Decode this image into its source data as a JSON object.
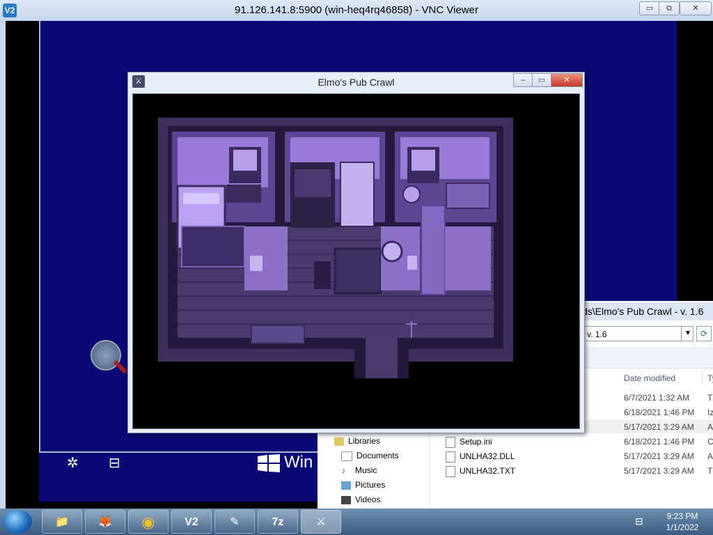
{
  "vnc": {
    "title": "91.126.141.8:5900 (win-heq4rq46858) - VNC Viewer",
    "icon_label": "V2",
    "minimize": "▭",
    "restore": "⧉",
    "close": "✕"
  },
  "desktop": {
    "win_text": "Win",
    "icons": [
      "settings-gear-icon",
      "network-monitor-icon"
    ]
  },
  "game": {
    "title": "Elmo's Pub Crawl",
    "minimize": "–",
    "maximize": "▭",
    "close": "✕"
  },
  "explorer": {
    "path_text": "ds\\Elmo's Pub Crawl - v. 1.6",
    "combo_value": "v. 1.6",
    "columns": {
      "date_modified": "Date modified",
      "type": "Ty"
    },
    "nav": [
      {
        "label": "Libraries",
        "icon": "libraries-icon"
      },
      {
        "label": "Documents",
        "icon": "documents-icon"
      },
      {
        "label": "Music",
        "icon": "music-icon"
      },
      {
        "label": "Pictures",
        "icon": "pictures-icon"
      },
      {
        "label": "Videos",
        "icon": "videos-icon"
      }
    ],
    "files": [
      {
        "name": "",
        "date": "6/7/2021 1:32 AM",
        "type": "T"
      },
      {
        "name": "",
        "date": "6/18/2021 1:46 PM",
        "type": "Iz"
      },
      {
        "name": "",
        "date": "5/17/2021 3:29 AM",
        "type": "A"
      },
      {
        "name": "Setup.ini",
        "date": "6/18/2021 1:46 PM",
        "type": "C"
      },
      {
        "name": "UNLHA32.DLL",
        "date": "5/17/2021 3:29 AM",
        "type": "A"
      },
      {
        "name": "UNLHA32.TXT",
        "date": "5/17/2021 3:29 AM",
        "type": "T"
      }
    ]
  },
  "taskbar": {
    "apps": [
      {
        "name": "file-explorer",
        "glyph": "📁"
      },
      {
        "name": "firefox",
        "glyph": "🦊"
      },
      {
        "name": "chrome",
        "glyph": "◉"
      },
      {
        "name": "vnc-viewer",
        "glyph": "V2"
      },
      {
        "name": "notepad",
        "glyph": "✎"
      },
      {
        "name": "7zip",
        "glyph": "7z"
      },
      {
        "name": "game",
        "glyph": "⚔"
      }
    ],
    "time": "9:23 PM",
    "date": "1/1/2022"
  },
  "colors": {
    "remote_desktop_blue": "#0a0a78",
    "game_floor_purple": "#5b4a8c",
    "game_wall_purple": "#8a6acb"
  }
}
